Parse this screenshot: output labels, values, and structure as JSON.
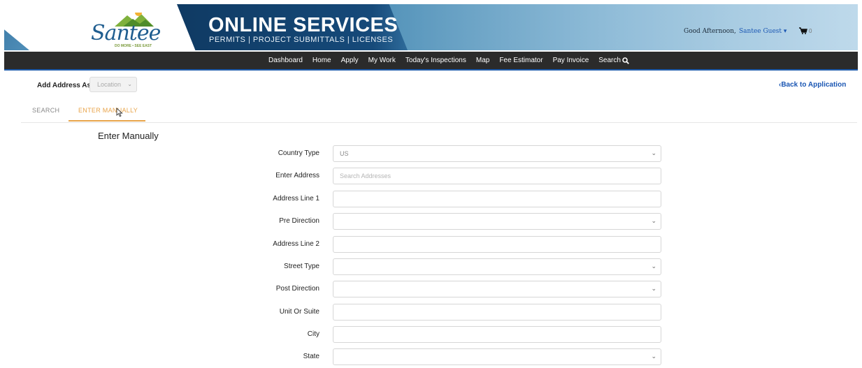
{
  "header": {
    "logo_text": "Santee",
    "logo_tagline": "DO MORE • SEE EAST",
    "title": "ONLINE SERVICES",
    "subtitle": "PERMITS | PROJECT SUBMITTALS | LICENSES",
    "greeting": "Good Afternoon,",
    "user_name": "Santee Guest",
    "user_caret": "▾",
    "cart_count": "0",
    "cart_icon": "cart-icon"
  },
  "nav": {
    "items": [
      {
        "label": "Dashboard"
      },
      {
        "label": "Home"
      },
      {
        "label": "Apply"
      },
      {
        "label": "My Work"
      },
      {
        "label": "Today's Inspections"
      },
      {
        "label": "Map"
      },
      {
        "label": "Fee Estimator"
      },
      {
        "label": "Pay Invoice"
      },
      {
        "label": "Search"
      }
    ]
  },
  "add_address": {
    "label": "Add Address As",
    "value": "Location",
    "back_link": "‹Back to Application"
  },
  "tabs": {
    "search": "SEARCH",
    "manual": "ENTER MANUALLY",
    "active": "manual"
  },
  "section_title": "Enter Manually",
  "form": {
    "country_type": {
      "label": "Country Type",
      "value": "US"
    },
    "enter_address": {
      "label": "Enter Address",
      "placeholder": "Search Addresses"
    },
    "address_line_1": {
      "label": "Address Line 1",
      "value": ""
    },
    "pre_direction": {
      "label": "Pre Direction",
      "value": ""
    },
    "address_line_2": {
      "label": "Address Line 2",
      "value": ""
    },
    "street_type": {
      "label": "Street Type",
      "value": ""
    },
    "post_direction": {
      "label": "Post Direction",
      "value": ""
    },
    "unit_or_suite": {
      "label": "Unit Or Suite",
      "value": ""
    },
    "city": {
      "label": "City",
      "value": ""
    },
    "state": {
      "label": "State",
      "value": ""
    }
  },
  "colors": {
    "accent_orange": "#e8a44a",
    "link_blue": "#1a56b3",
    "nav_bg": "#2b2b2b",
    "banner_dark": "#164a7a"
  }
}
